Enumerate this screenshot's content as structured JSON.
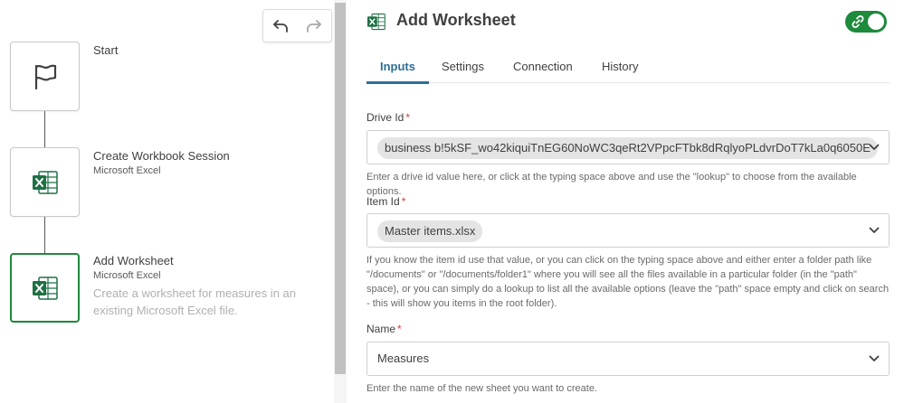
{
  "canvas": {
    "nodes": [
      {
        "title": "Start",
        "subtitle": "",
        "description": "",
        "icon": "flag-icon",
        "selected": false
      },
      {
        "title": "Create Workbook Session",
        "subtitle": "Microsoft Excel",
        "description": "",
        "icon": "excel-icon",
        "selected": false
      },
      {
        "title": "Add Worksheet",
        "subtitle": "Microsoft Excel",
        "description": "Create a worksheet for measures in an existing Microsoft Excel file.",
        "icon": "excel-icon",
        "selected": true
      }
    ],
    "toolbar": {
      "undo_icon": "undo-icon",
      "redo_icon": "redo-icon"
    }
  },
  "panel": {
    "title": "Add Worksheet",
    "icon": "excel-icon",
    "toggle": {
      "state": "on",
      "icon": "link-icon",
      "color": "#1e8a3c"
    },
    "tabs": [
      {
        "label": "Inputs",
        "active": true
      },
      {
        "label": "Settings",
        "active": false
      },
      {
        "label": "Connection",
        "active": false
      },
      {
        "label": "History",
        "active": false
      }
    ],
    "fields": {
      "drive_id": {
        "label": "Drive Id",
        "required_mark": "*",
        "value": "business b!5kSF_wo42kiquiTnEG60NoWC3qeRt2VPpcFTbk8dRqlyoPLdvrDoT7kLa0q6050E",
        "help": "Enter a drive id value here, or click at the typing space above and use the \"lookup\" to choose from the available options."
      },
      "item_id": {
        "label": "Item Id",
        "required_mark": "*",
        "value": "Master items.xlsx",
        "help": "If you know the item id use that value, or you can click on the typing space above and either enter a folder path like \"/documents\" or \"/documents/folder1\" where you will see all the files available in a particular folder (in the \"path\" space), or you can simply do a lookup to list all the available options (leave the \"path\" space empty and click on search - this will show you items in the root folder)."
      },
      "name": {
        "label": "Name",
        "required_mark": "*",
        "value": "Measures",
        "help": "Enter the name of the new sheet you want to create."
      }
    }
  },
  "colors": {
    "accent": "#2d6e96",
    "excel_green": "#1e7145",
    "selected_border": "#1e8a3c",
    "required": "#d83b3b"
  }
}
